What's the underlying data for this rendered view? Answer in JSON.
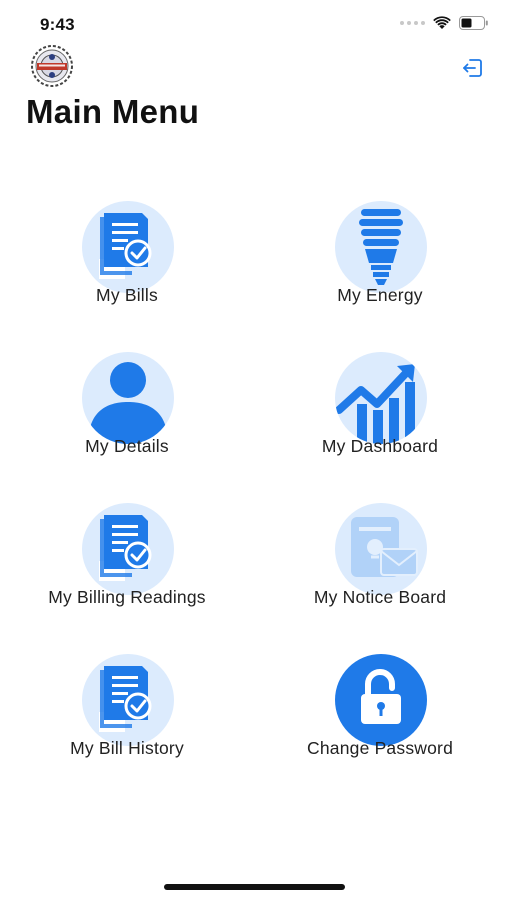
{
  "status_bar": {
    "time": "9:43"
  },
  "header": {
    "title": "Main Menu"
  },
  "menu": {
    "items": [
      {
        "label": "My Bills",
        "icon": "bill-document-icon"
      },
      {
        "label": "My Energy",
        "icon": "energy-bulb-icon"
      },
      {
        "label": "My Details",
        "icon": "user-icon"
      },
      {
        "label": "My Dashboard",
        "icon": "chart-trend-icon"
      },
      {
        "label": "My Billing Readings",
        "icon": "bill-document-icon"
      },
      {
        "label": "My Notice Board",
        "icon": "notice-board-icon"
      },
      {
        "label": "My Bill History",
        "icon": "bill-document-icon"
      },
      {
        "label": "Change Password",
        "icon": "unlock-icon"
      }
    ]
  },
  "colors": {
    "accent": "#1f7ae8",
    "circle_background": "#dcebfd"
  }
}
